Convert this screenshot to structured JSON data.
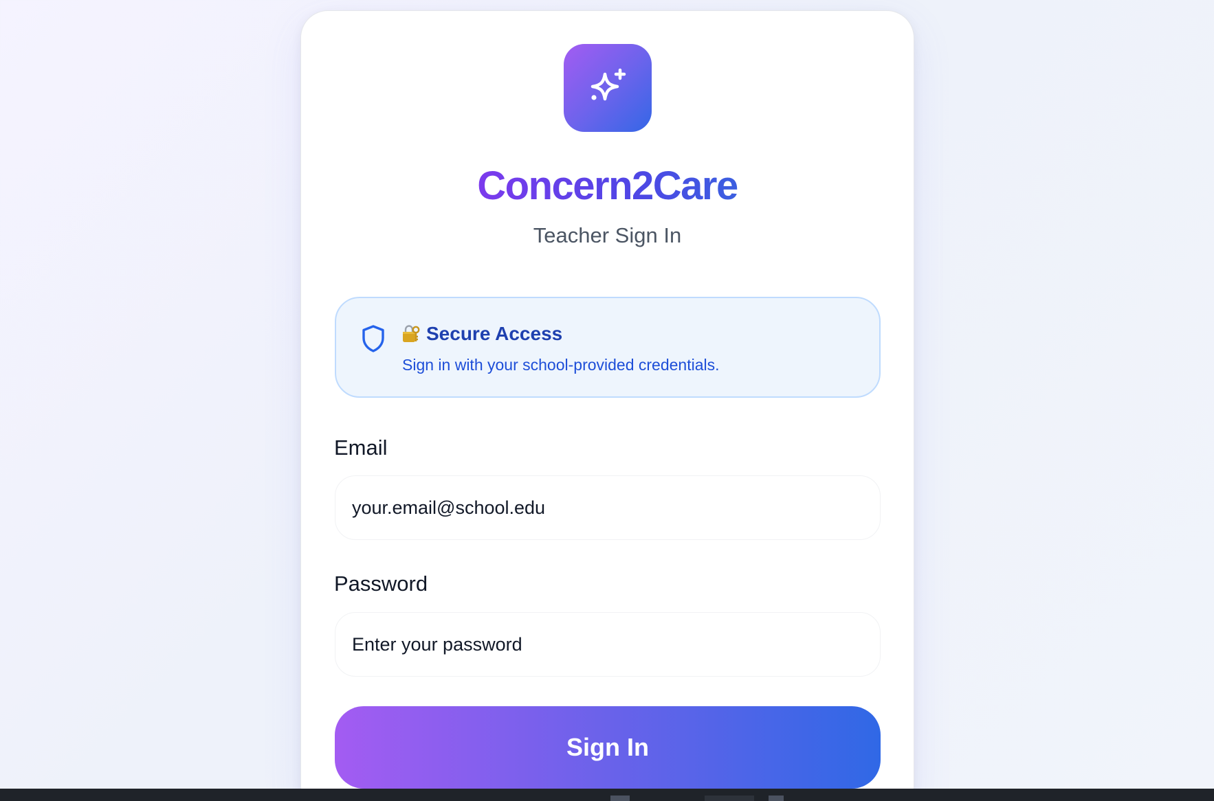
{
  "brand": {
    "name": "Concern2Care",
    "subtitle": "Teacher Sign In",
    "logo_icon": "sparkles-icon"
  },
  "notice": {
    "icon": "shield-icon",
    "emoji_icon": "locked-with-key-icon",
    "title": "Secure Access",
    "message": "Sign in with your school-provided credentials."
  },
  "form": {
    "email": {
      "label": "Email",
      "placeholder": "your.email@school.edu"
    },
    "password": {
      "label": "Password",
      "placeholder": "Enter your password"
    },
    "submit_label": "Sign In"
  },
  "colors": {
    "gradient_start": "#a35cf2",
    "gradient_end": "#3068e6",
    "notice_background": "#eef5fd",
    "notice_text": "#1d4ed8"
  }
}
